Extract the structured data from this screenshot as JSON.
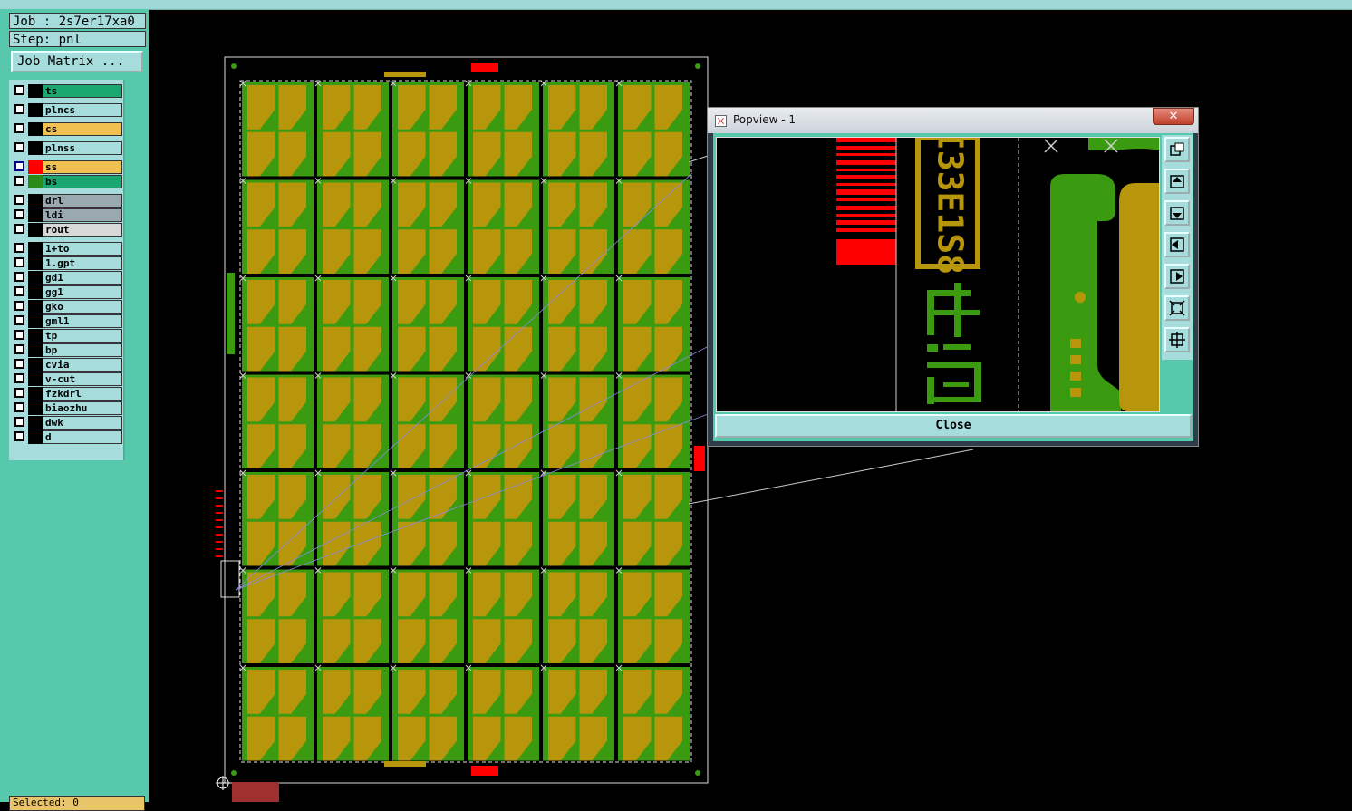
{
  "job_label": "Job : 2s7er17xa0",
  "step_label": "Step: pnl",
  "job_matrix_button": "Job Matrix ...",
  "layers": [
    {
      "name": "ts",
      "color": "#1aa870"
    },
    {
      "name": "plncs",
      "color": "#a7dcdc"
    },
    {
      "name": "cs",
      "color": "#f0c050"
    },
    {
      "name": "plnss",
      "color": "#a7dcdc"
    },
    {
      "name": "ss",
      "color": "#f0c050",
      "active": true,
      "swatch": "#ff0000"
    },
    {
      "name": "bs",
      "color": "#1aa870",
      "swatch": "#2a8a1a"
    },
    {
      "name": "drl",
      "color": "#9aa8b0"
    },
    {
      "name": "ldi",
      "color": "#9aa8b0"
    },
    {
      "name": "rout",
      "color": "#d8d8d8"
    },
    {
      "name": "1+to",
      "color": "#a7dcdc"
    },
    {
      "name": "1.gpt",
      "color": "#a7dcdc"
    },
    {
      "name": "gd1",
      "color": "#a7dcdc"
    },
    {
      "name": "gg1",
      "color": "#a7dcdc"
    },
    {
      "name": "gko",
      "color": "#a7dcdc"
    },
    {
      "name": "gml1",
      "color": "#a7dcdc"
    },
    {
      "name": "tp",
      "color": "#a7dcdc"
    },
    {
      "name": "bp",
      "color": "#a7dcdc"
    },
    {
      "name": "cvia",
      "color": "#a7dcdc"
    },
    {
      "name": "v-cut",
      "color": "#a7dcdc"
    },
    {
      "name": "fzkdrl",
      "color": "#a7dcdc"
    },
    {
      "name": "biaozhu",
      "color": "#a7dcdc"
    },
    {
      "name": "dwk",
      "color": "#a7dcdc"
    },
    {
      "name": "d",
      "color": "#a7dcdc"
    }
  ],
  "bottom_tab": "Selected: 0",
  "popview": {
    "title": "Popview - 1",
    "close_label": "Close",
    "window_close": "✕",
    "zoom_text": "I33E1S8"
  },
  "colors": {
    "copper": "#b8960c",
    "green": "#3a9a10",
    "red": "#ff0000",
    "panel": "#56c9ad"
  }
}
